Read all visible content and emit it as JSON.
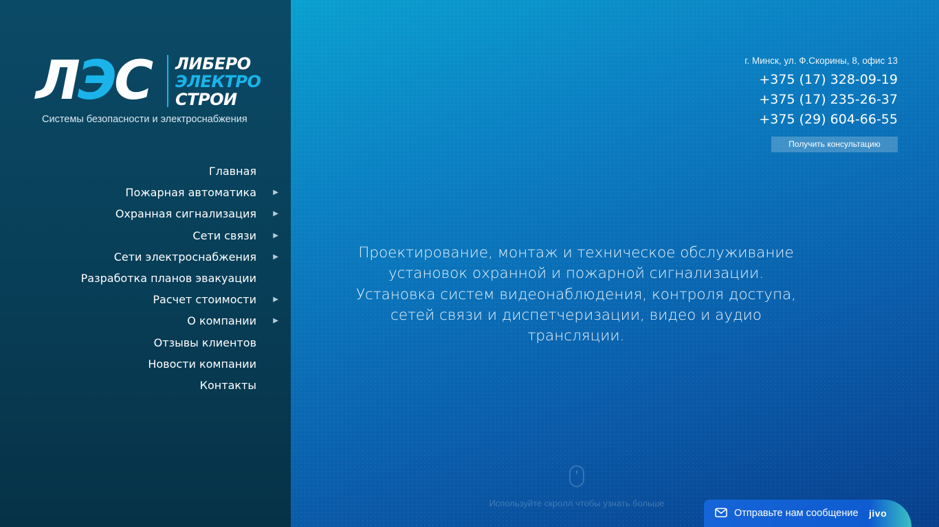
{
  "brand": {
    "logo_big_part1": "Л",
    "logo_big_part2": "Э",
    "logo_big_part3": "С",
    "logo_word1": "ЛИБЕРО",
    "logo_word2": "ЭЛЕКТРО",
    "logo_word3": "СТРОИ",
    "tagline": "Системы безопасности и электроснабжения",
    "accent_color": "#1ab4ea"
  },
  "nav": {
    "items": [
      {
        "label": "Главная",
        "has_submenu": false
      },
      {
        "label": "Пожарная автоматика",
        "has_submenu": true
      },
      {
        "label": "Охранная сигнализация",
        "has_submenu": true
      },
      {
        "label": "Сети связи",
        "has_submenu": true
      },
      {
        "label": "Сети электроснабжения",
        "has_submenu": true
      },
      {
        "label": "Разработка планов эвакуации",
        "has_submenu": false
      },
      {
        "label": "Расчет стоимости",
        "has_submenu": true
      },
      {
        "label": "О компании",
        "has_submenu": true
      },
      {
        "label": "Отзывы клиентов",
        "has_submenu": false
      },
      {
        "label": "Новости компании",
        "has_submenu": false
      },
      {
        "label": "Контакты",
        "has_submenu": false
      }
    ],
    "arrow_icon": "chevron-right-icon"
  },
  "contacts": {
    "address": "г. Минск, ул. Ф.Скорины, 8, офис 13",
    "phones": [
      "+375 (17) 328-09-19",
      "+375 (17) 235-26-37",
      "+375 (29) 604-66-55"
    ],
    "consult_button": "Получить консультацию"
  },
  "hero": {
    "lines": [
      "Проектирование, монтаж и техническое обслуживание",
      "установок охранной и пожарной сигнализации.",
      "Установка систем видеонаблюдения, контроля доступа,",
      "сетей связи и диспетчеризации, видео и аудио",
      "трансляции."
    ]
  },
  "scroll_hint": {
    "icon": "mouse-icon",
    "text": "Используйте скролл чтобы узнать больше"
  },
  "chat": {
    "icon": "envelope-icon",
    "label": "Отправьте нам сообщение",
    "brand": "jivo"
  }
}
